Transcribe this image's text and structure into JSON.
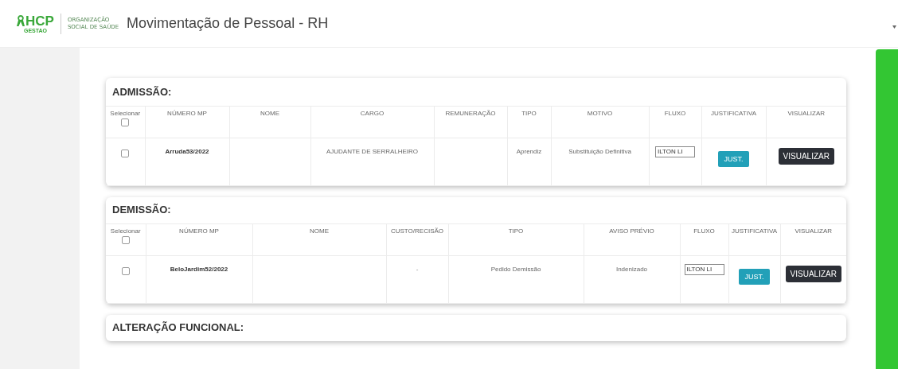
{
  "header": {
    "logo_main": "HCP",
    "logo_sub": "GESTAO",
    "org_line_1": "ORGANIZAÇÃO",
    "org_line_2": "SOCIAL DE SAÚDE",
    "title": "Movimentação de Pessoal - RH"
  },
  "sections": [
    {
      "title": "ADMISSÃO:",
      "columns": [
        "Selecionar",
        "NÚMERO MP",
        "NOME",
        "CARGO",
        "REMUNERAÇÃO",
        "TIPO",
        "MOTIVO",
        "FLUXO",
        "JUSTIFICATIVA",
        "VISUALIZAR"
      ],
      "select_all_checked": false,
      "rows": [
        {
          "cells": [
            {
              "kind": "checkbox",
              "checked": false
            },
            {
              "kind": "id",
              "text": "Arruda53/2022"
            },
            {
              "kind": "empty"
            },
            {
              "kind": "text",
              "text": "AJUDANTE DE SERRALHEIRO"
            },
            {
              "kind": "empty"
            },
            {
              "kind": "text",
              "text": "Aprendiz"
            },
            {
              "kind": "text",
              "text": "Substituição Definitiva"
            },
            {
              "kind": "field",
              "value": "ILTON LI"
            },
            {
              "kind": "just",
              "label": "JUST."
            },
            {
              "kind": "view",
              "label": "VISUALIZAR"
            }
          ]
        }
      ]
    },
    {
      "title": "DEMISSÃO:",
      "columns": [
        "Selecionar",
        "NÚMERO MP",
        "NOME",
        "CUSTO/RECISÃO",
        "TIPO",
        "AVISO PRÉVIO",
        "FLUXO",
        "JUSTIFICATIVA",
        "VISUALIZAR"
      ],
      "select_all_checked": false,
      "rows": [
        {
          "cells": [
            {
              "kind": "checkbox",
              "checked": false
            },
            {
              "kind": "id",
              "text": "BeloJardim52/2022"
            },
            {
              "kind": "empty"
            },
            {
              "kind": "faint",
              "text": "-"
            },
            {
              "kind": "text",
              "text": "Pedido Demissão"
            },
            {
              "kind": "text",
              "text": "Indenizado"
            },
            {
              "kind": "field",
              "value": "ILTON LI"
            },
            {
              "kind": "just",
              "label": "JUST."
            },
            {
              "kind": "view",
              "label": "VISUALIZAR"
            }
          ]
        }
      ]
    },
    {
      "title": "ALTERAÇÃO FUNCIONAL:"
    }
  ]
}
